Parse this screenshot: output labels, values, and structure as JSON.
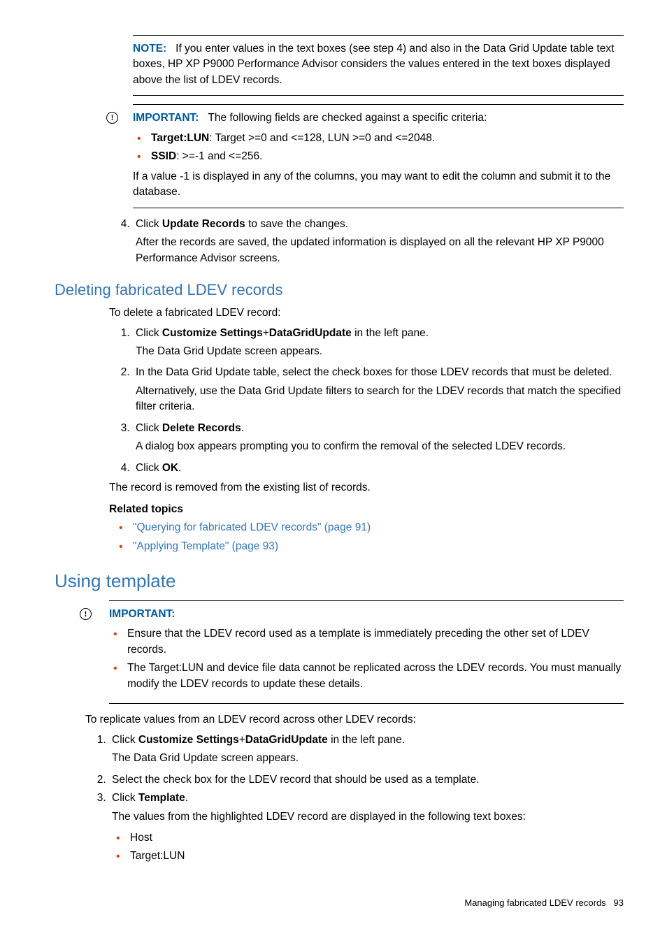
{
  "note": {
    "label": "NOTE:",
    "text": "If you enter values in the text boxes (see step 4) and also in the Data Grid Update table text boxes, HP XP P9000 Performance Advisor considers the values entered in the text boxes displayed above the list of LDEV records."
  },
  "important1": {
    "label": "IMPORTANT:",
    "intro": "The following fields are checked against a specific criteria:",
    "b1_label": "Target:LUN",
    "b1_text": ": Target >=0 and <=128, LUN >=0 and <=2048.",
    "b2_label": "SSID",
    "b2_text": ": >=-1 and <=256.",
    "tail": "If a value -1 is displayed in any of the columns, you may want to edit the column and submit it to the database."
  },
  "step4": {
    "pre": "Click ",
    "bold": "Update Records",
    "post": " to save the changes.",
    "para": "After the records are saved, the updated information is displayed on all the relevant HP XP P9000 Performance Advisor screens."
  },
  "sec1": {
    "title": "Deleting fabricated LDEV records",
    "intro": "To delete a fabricated LDEV record:",
    "s1_pre": "Click ",
    "s1_b1": "Customize Settings",
    "s1_mid": "+",
    "s1_b2": "DataGridUpdate",
    "s1_post": " in the left pane.",
    "s1_para": "The Data Grid Update screen appears.",
    "s2": "In the Data Grid Update table, select the check boxes for those LDEV records that must be deleted.",
    "s2_para": "Alternatively, use the Data Grid Update filters to search for the LDEV records that match the specified filter criteria.",
    "s3_pre": "Click ",
    "s3_bold": "Delete Records",
    "s3_post": ".",
    "s3_para": "A dialog box appears prompting you to confirm the removal of the selected LDEV records.",
    "s4_pre": "Click ",
    "s4_bold": "OK",
    "s4_post": ".",
    "outro": "The record is removed from the existing list of records.",
    "related_label": "Related topics",
    "link1": "\"Querying for fabricated LDEV records\" (page 91)",
    "link2": "\"Applying Template\" (page 93)"
  },
  "sec2": {
    "title": "Using template",
    "imp_label": "IMPORTANT:",
    "imp_b1": "Ensure that the LDEV record used as a template is immediately preceding the other set of LDEV records.",
    "imp_b2": "The Target:LUN and device file data cannot be replicated across the LDEV records. You must manually modify the LDEV records to update these details.",
    "intro": "To replicate values from an LDEV record across other LDEV records:",
    "s1_pre": "Click ",
    "s1_b1": "Customize Settings",
    "s1_mid": "+",
    "s1_b2": "DataGridUpdate",
    "s1_post": " in the left pane.",
    "s1_para": "The Data Grid Update screen appears.",
    "s2": "Select the check box for the LDEV record that should be used as a template.",
    "s3_pre": "Click ",
    "s3_bold": "Template",
    "s3_post": ".",
    "s3_para": "The values from the highlighted LDEV record are displayed in the following text boxes:",
    "s3_sub1": "Host",
    "s3_sub2": "Target:LUN"
  },
  "footer": {
    "text": "Managing fabricated LDEV records",
    "page": "93"
  }
}
